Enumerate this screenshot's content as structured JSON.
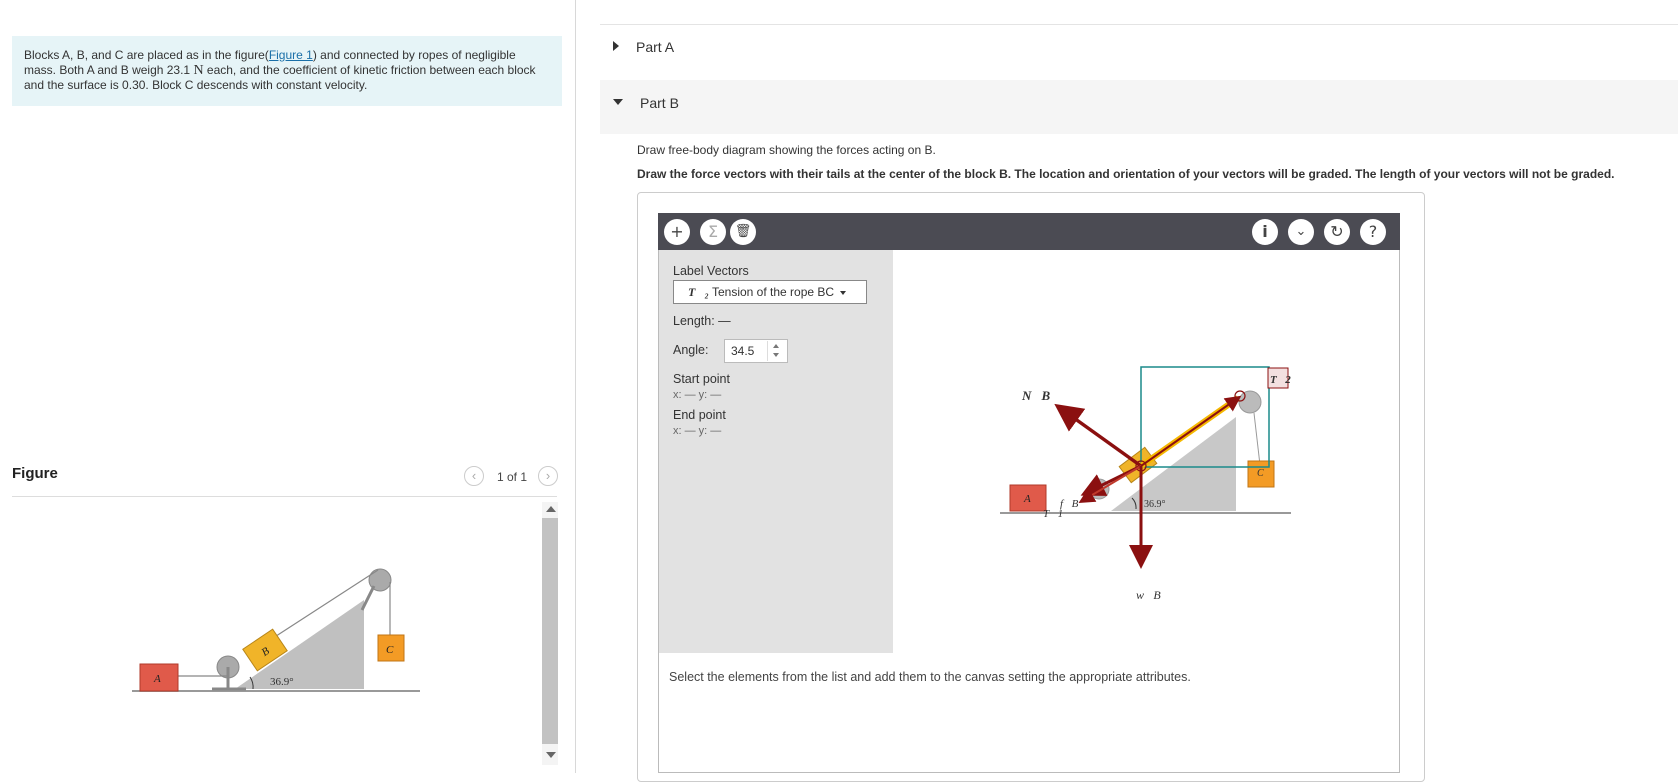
{
  "problem": {
    "text_before_link": "Blocks A, B, and C are placed as in the figure(",
    "link": "Figure 1",
    "text_after_link": ") and connected by ropes of negligible mass. Both A and B weigh 23.1 ",
    "unit": "N",
    "text_end": " each, and the coefficient of kinetic friction between each block and the surface is 0.30. Block C  descends with constant velocity."
  },
  "figure_panel": {
    "title": "Figure",
    "page_count": "1 of 1",
    "figure": {
      "block_a": "A",
      "block_b": "B",
      "block_c": "C",
      "angle": "36.9°"
    }
  },
  "parts": {
    "a": {
      "label": "Part A"
    },
    "b": {
      "label": "Part B"
    }
  },
  "instructions": {
    "line1": "Draw free-body diagram showing the forces acting on B.",
    "line2": "Draw the force vectors with their tails at the center of the block B. The location and orientation of your vectors will be graded. The length of your vectors will not be graded."
  },
  "toolbar": {
    "add": "+",
    "sigma": "Σ",
    "trash": "🗑",
    "info": "i",
    "more": "⌄",
    "reset": "↻",
    "help": "?"
  },
  "side_panel": {
    "label_vectors": "Label Vectors",
    "selected_vector_symbol": "T⃗₂",
    "selected_vector": "Tension of the rope BC",
    "length_label": "Length: —",
    "angle_label": "Angle:",
    "angle_value": "34.5",
    "start_point_label": "Start point",
    "start_point_value": "x: — y: —",
    "end_point_label": "End point",
    "end_point_value": "x: — y: —"
  },
  "canvas": {
    "vector_labels": {
      "n": "N⃗B",
      "f": "f⃗B",
      "t1": "T⃗1",
      "t2": "T⃗2",
      "w": "w⃗B"
    },
    "block_a": "A",
    "block_c": "C",
    "angle": "36.9°",
    "colors": {
      "vector": "#8b1010",
      "selected": "#f5b800",
      "box": "#1a8a8a"
    }
  },
  "hint": "Select the elements from the list and add them to the canvas setting the appropriate attributes."
}
